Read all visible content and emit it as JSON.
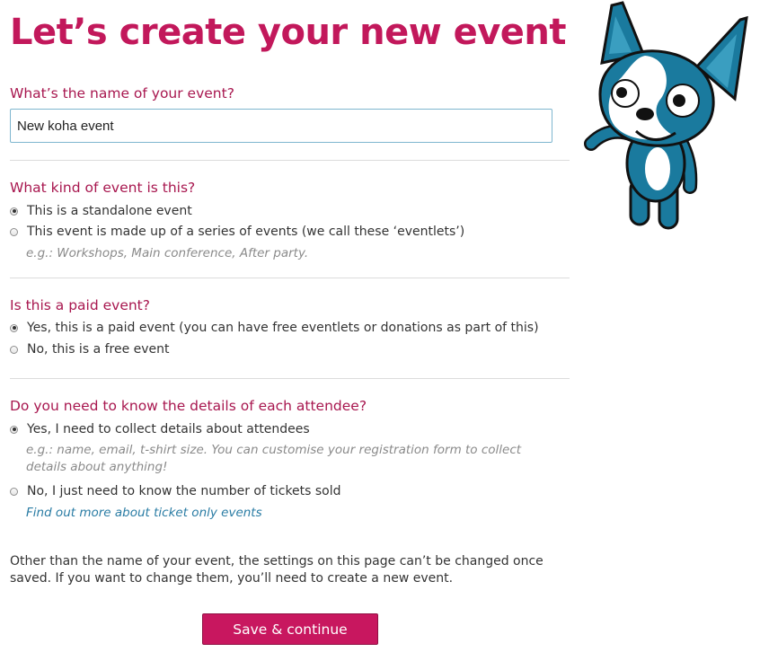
{
  "page": {
    "title": "Let’s create your new event"
  },
  "event_name": {
    "question": "What’s the name of your event?",
    "value": "New koha event"
  },
  "event_kind": {
    "question": "What kind of event is this?",
    "options": [
      {
        "label": "This is a standalone event",
        "checked": true
      },
      {
        "label": "This event is made up of a series of events (we call these ‘eventlets’)",
        "checked": false
      }
    ],
    "hint": "e.g.: Workshops, Main conference, After party."
  },
  "paid_event": {
    "question": "Is this a paid event?",
    "options": [
      {
        "label": "Yes, this is a paid event (you can have free eventlets or donations as part of this)",
        "checked": true
      },
      {
        "label": "No, this is a free event",
        "checked": false
      }
    ]
  },
  "attendee_details": {
    "question": "Do you need to know the details of each attendee?",
    "options": [
      {
        "label": "Yes, I need to collect details about attendees",
        "checked": true
      },
      {
        "label": "No, I just need to know the number of tickets sold",
        "checked": false
      }
    ],
    "hint": "e.g.: name, email, t-shirt size. You can customise your registration form to collect details about anything!",
    "link": "Find out more about ticket only events"
  },
  "note": "Other than the name of your event, the settings on this page can’t be changed once saved. If you want to change them, you’ll need to create a new event.",
  "save_button": {
    "label": "Save & continue"
  },
  "colors": {
    "accent": "#c2185b",
    "link": "#2a7ca4",
    "mascot_blue": "#1a7a9e"
  },
  "mascot": {
    "icon": "dog-mascot-illustration"
  }
}
